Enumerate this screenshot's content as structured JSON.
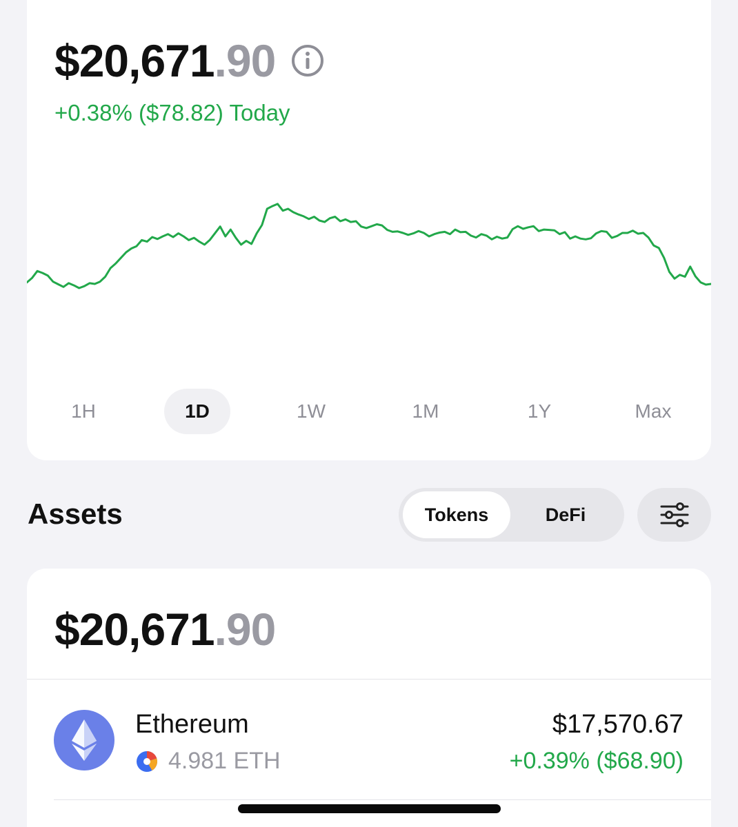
{
  "portfolio": {
    "balance_main": "$20,671",
    "balance_cents": ".90",
    "change_text": "+0.38% ($78.82) Today",
    "positive_color": "#22a84a",
    "periods": [
      "1H",
      "1D",
      "1W",
      "1M",
      "1Y",
      "Max"
    ],
    "active_period": "1D"
  },
  "chart_data": {
    "type": "line",
    "title": "",
    "xlabel": "",
    "ylabel": "",
    "grid": false,
    "series": [
      {
        "values": [
          20510,
          20522,
          20540,
          20535,
          20528,
          20512,
          20505,
          20498,
          20508,
          20502,
          20495,
          20500,
          20508,
          20506,
          20512,
          20525,
          20548,
          20560,
          20575,
          20590,
          20600,
          20606,
          20622,
          20618,
          20630,
          20625,
          20632,
          20638,
          20630,
          20640,
          20632,
          20622,
          20628,
          20618,
          20610,
          20622,
          20640,
          20658,
          20632,
          20650,
          20628,
          20610,
          20620,
          20612,
          20640,
          20662,
          20705,
          20712,
          20718,
          20700,
          20705,
          20696,
          20690,
          20685,
          20678,
          20684,
          20674,
          20670,
          20680,
          20684,
          20672,
          20677,
          20670,
          20672,
          20658,
          20654,
          20659,
          20664,
          20661,
          20649,
          20644,
          20645,
          20641,
          20636,
          20640,
          20646,
          20641,
          20632,
          20638,
          20642,
          20644,
          20638,
          20650,
          20643,
          20644,
          20634,
          20629,
          20638,
          20634,
          20624,
          20631,
          20626,
          20629,
          20651,
          20659,
          20652,
          20656,
          20659,
          20646,
          20650,
          20649,
          20648,
          20638,
          20643,
          20626,
          20632,
          20626,
          20624,
          20627,
          20640,
          20646,
          20644,
          20628,
          20633,
          20641,
          20641,
          20647,
          20639,
          20641,
          20629,
          20608,
          20601,
          20575,
          20538,
          20520,
          20530,
          20525,
          20552,
          20526,
          20510,
          20504,
          20506
        ]
      }
    ],
    "ylim": [
      20400,
      20820
    ]
  },
  "assets": {
    "title": "Assets",
    "segments": {
      "tokens": "Tokens",
      "defi": "DeFi"
    },
    "total_main": "$20,671",
    "total_cents": ".90",
    "tokens": [
      {
        "name": "Ethereum",
        "amount": "4.981 ETH",
        "value": "$17,570.67",
        "change": "+0.39% ($68.90)",
        "icon": "ethereum-logo",
        "logo_color": "#6a80e8"
      }
    ]
  }
}
